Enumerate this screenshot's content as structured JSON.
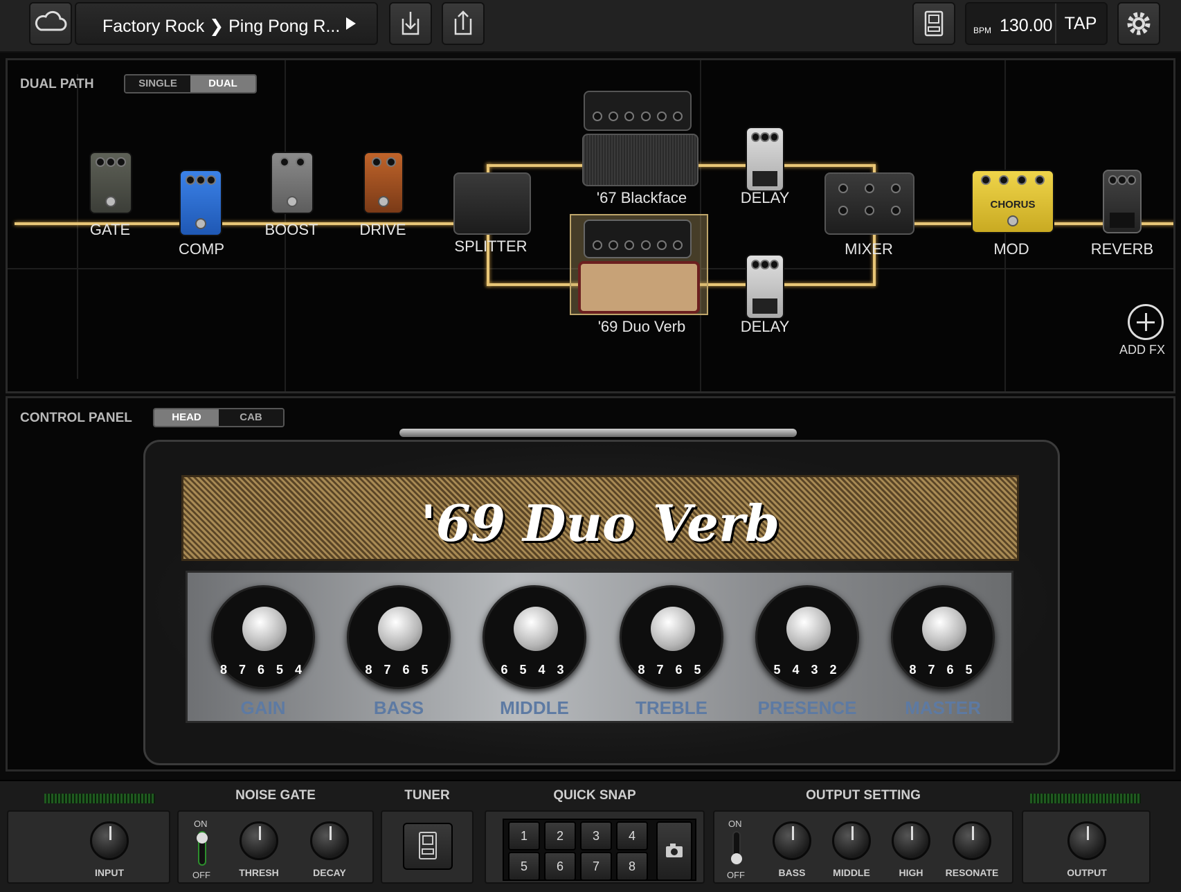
{
  "topbar": {
    "preset_path": "Factory Rock ❯ Ping Pong R...",
    "bpm_label": "BPM",
    "bpm_value": "130.00",
    "tap_label": "TAP"
  },
  "signal_path": {
    "section_title": "DUAL PATH",
    "modes": [
      "SINGLE",
      "DUAL"
    ],
    "selected_mode": "DUAL",
    "pedal_labels": {
      "gate": "GATE",
      "comp": "COMP",
      "boost": "BOOST",
      "drive": "DRIVE",
      "splitter": "SPLITTER",
      "amp_top": "'67 Blackface",
      "amp_bottom": "'69 Duo Verb",
      "delay_top": "DELAY",
      "delay_bottom": "DELAY",
      "mixer": "MIXER",
      "mod": "MOD",
      "reverb": "REVERB"
    },
    "chorus_text": "CHORUS",
    "add_fx_label": "ADD FX"
  },
  "control_panel": {
    "section_title": "CONTROL PANEL",
    "tabs": [
      "HEAD",
      "CAB"
    ],
    "selected_tab": "HEAD",
    "amp_name": "'69 Duo Verb",
    "knobs": [
      {
        "label": "GAIN",
        "nums": "8 7 6 5 4"
      },
      {
        "label": "BASS",
        "nums": "8 7 6 5"
      },
      {
        "label": "MIDDLE",
        "nums": "6 5 4 3"
      },
      {
        "label": "TREBLE",
        "nums": "8 7 6 5"
      },
      {
        "label": "PRESENCE",
        "nums": "5 4 3 2"
      },
      {
        "label": "MASTER",
        "nums": "8 7 6 5"
      }
    ]
  },
  "bottom_bar": {
    "input_label": "INPUT",
    "noise_gate": {
      "title": "NOISE GATE",
      "on": "ON",
      "off": "OFF",
      "thresh": "THRESH",
      "decay": "DECAY"
    },
    "tuner": {
      "title": "TUNER"
    },
    "quick_snap": {
      "title": "QUICK SNAP",
      "slots": [
        "1",
        "2",
        "3",
        "4",
        "5",
        "6",
        "7",
        "8"
      ]
    },
    "output_setting": {
      "title": "OUTPUT SETTING",
      "on": "ON",
      "off": "OFF",
      "bass": "BASS",
      "middle": "MIDDLE",
      "high": "HIGH",
      "resonate": "RESONATE"
    },
    "output_label": "OUTPUT"
  },
  "colors": {
    "wire": "#e8c677",
    "label_blue": "#5d7aa3",
    "chorus_yellow": "#e2c532",
    "comp_blue": "#2f6fd1"
  }
}
